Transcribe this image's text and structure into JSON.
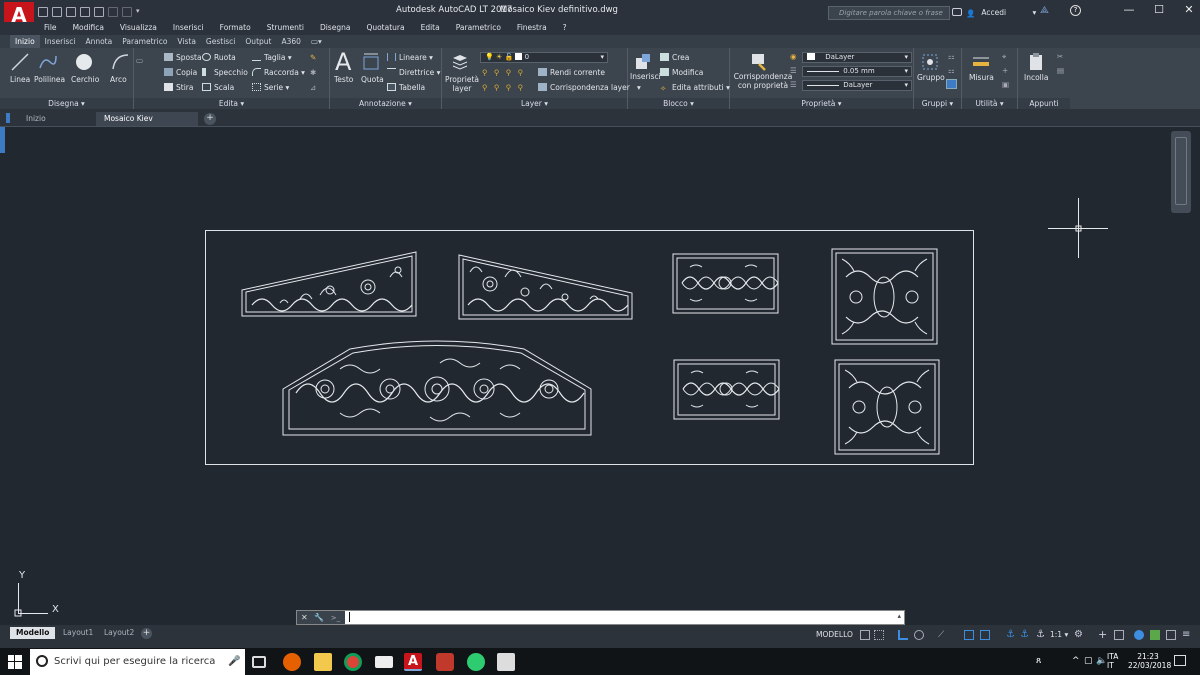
{
  "app": {
    "logo": "A",
    "title": "Autodesk AutoCAD LT 2017",
    "file": "Mosaico Kiev definitivo.dwg"
  },
  "search": {
    "placeholder": "Digitare parola chiave o frase"
  },
  "signin": {
    "label": "Accedi"
  },
  "menus": [
    "File",
    "Modifica",
    "Visualizza",
    "Inserisci",
    "Formato",
    "Strumenti",
    "Disegna",
    "Quotatura",
    "Edita",
    "Parametrico",
    "Finestra",
    "?"
  ],
  "ribbon_tabs": [
    "Inizio",
    "Inserisci",
    "Annota",
    "Parametrico",
    "Vista",
    "Gestisci",
    "Output",
    "A360"
  ],
  "active_ribbon_tab": "Inizio",
  "panels": {
    "disegna": {
      "label": "Disegna",
      "tools": [
        "Linea",
        "Polilinea",
        "Cerchio",
        "Arco"
      ]
    },
    "edita": {
      "label": "Edita",
      "tools": [
        "Sposta",
        "Ruota",
        "Taglia",
        "Copia",
        "Specchio",
        "Raccorda",
        "Stira",
        "Scala",
        "Serie"
      ]
    },
    "annotazione": {
      "label": "Annotazione",
      "tools": [
        "Testo",
        "Quota",
        "Lineare",
        "Direttrice",
        "Tabella"
      ]
    },
    "layer": {
      "label": "Layer",
      "tools": [
        "Proprietà layer",
        "Rendi corrente",
        "Corrispondenza layer"
      ],
      "current_layer": "0"
    },
    "blocco": {
      "label": "Blocco",
      "tools": [
        "Inserisci",
        "Crea",
        "Modifica",
        "Edita attributi"
      ]
    },
    "proprieta": {
      "label": "Proprietà",
      "tools": [
        "Corrispondenza con proprietà"
      ],
      "color": "DaLayer",
      "lineweight": "0.05 mm",
      "linetype": "DaLayer"
    },
    "gruppi": {
      "label": "Gruppi",
      "tools": [
        "Gruppo"
      ]
    },
    "utilita": {
      "label": "Utilità",
      "tools": [
        "Misura"
      ]
    },
    "appunti": {
      "label": "Appunti",
      "tools": [
        "Incolla"
      ]
    }
  },
  "doc_tabs": [
    "Inizio",
    "Mosaico Kiev definitivo"
  ],
  "active_doc_tab": "Mosaico Kiev definitivo",
  "ucs": {
    "x": "X",
    "y": "Y"
  },
  "command": {
    "prompt": ">_",
    "value": ""
  },
  "layout_tabs": [
    "Modello",
    "Layout1",
    "Layout2"
  ],
  "active_layout": "Modello",
  "status": {
    "mode": "MODELLO",
    "scale": "1:1"
  },
  "taskbar": {
    "search_placeholder": "Scrivi qui per eseguire la ricerca",
    "lang1": "ITA",
    "lang2": "IT",
    "time": "21:23",
    "date": "22/03/2018"
  },
  "colors": {
    "bg": "#212830",
    "ribbon": "#3c444e",
    "accent": "#c8141b",
    "drawing_lines": "#e6e9ec"
  }
}
